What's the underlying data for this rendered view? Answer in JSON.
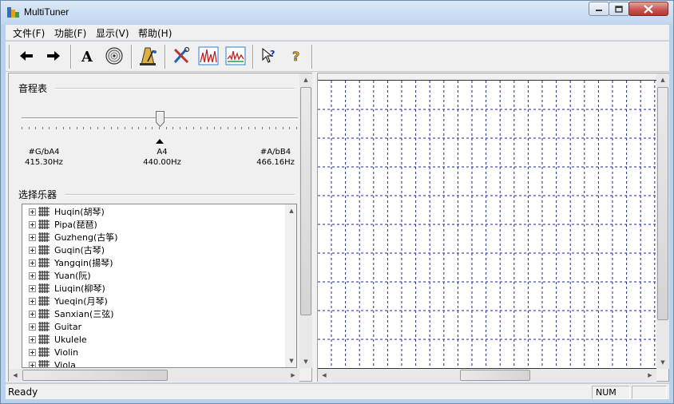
{
  "window": {
    "title": "MultiTuner"
  },
  "menu": [
    {
      "label": "文件(F)"
    },
    {
      "label": "功能(F)"
    },
    {
      "label": "显示(V)"
    },
    {
      "label": "帮助(H)"
    }
  ],
  "toolbar": {
    "buttons": [
      {
        "icon": "arrow-left-icon"
      },
      {
        "icon": "arrow-right-icon"
      },
      {
        "icon": "font-icon"
      },
      {
        "icon": "speaker-icon"
      },
      {
        "icon": "metronome-icon"
      },
      {
        "icon": "tools-icon"
      },
      {
        "icon": "spectrum-icon"
      },
      {
        "icon": "waveform-icon"
      },
      {
        "icon": "context-help-icon"
      },
      {
        "icon": "help-icon"
      }
    ]
  },
  "pitch": {
    "group_label": "音程表",
    "left_note": "#G/bA4",
    "left_freq": "415.30Hz",
    "center_note": "A4",
    "center_freq": "440.00Hz",
    "right_note": "#A/bB4",
    "right_freq": "466.16Hz"
  },
  "instruments": {
    "group_label": "选择乐器",
    "items": [
      {
        "label": "Huqin(胡琴)"
      },
      {
        "label": "Pipa(琵琶)"
      },
      {
        "label": "Guzheng(古筝)"
      },
      {
        "label": "Guqin(古琴)"
      },
      {
        "label": "Yangqin(揚琴)"
      },
      {
        "label": "Yuan(阮)"
      },
      {
        "label": "Liuqin(柳琴)"
      },
      {
        "label": "Yueqin(月琴)"
      },
      {
        "label": "Sanxian(三弦)"
      },
      {
        "label": "Guitar"
      },
      {
        "label": "Ukulele"
      },
      {
        "label": "Violin"
      },
      {
        "label": "Viola"
      }
    ]
  },
  "status": {
    "text": "Ready",
    "num": "NUM"
  },
  "colors": {
    "grid_line": "#1f2a8a",
    "title_bg": "#c2d7ef",
    "close_red": "#c75050"
  }
}
